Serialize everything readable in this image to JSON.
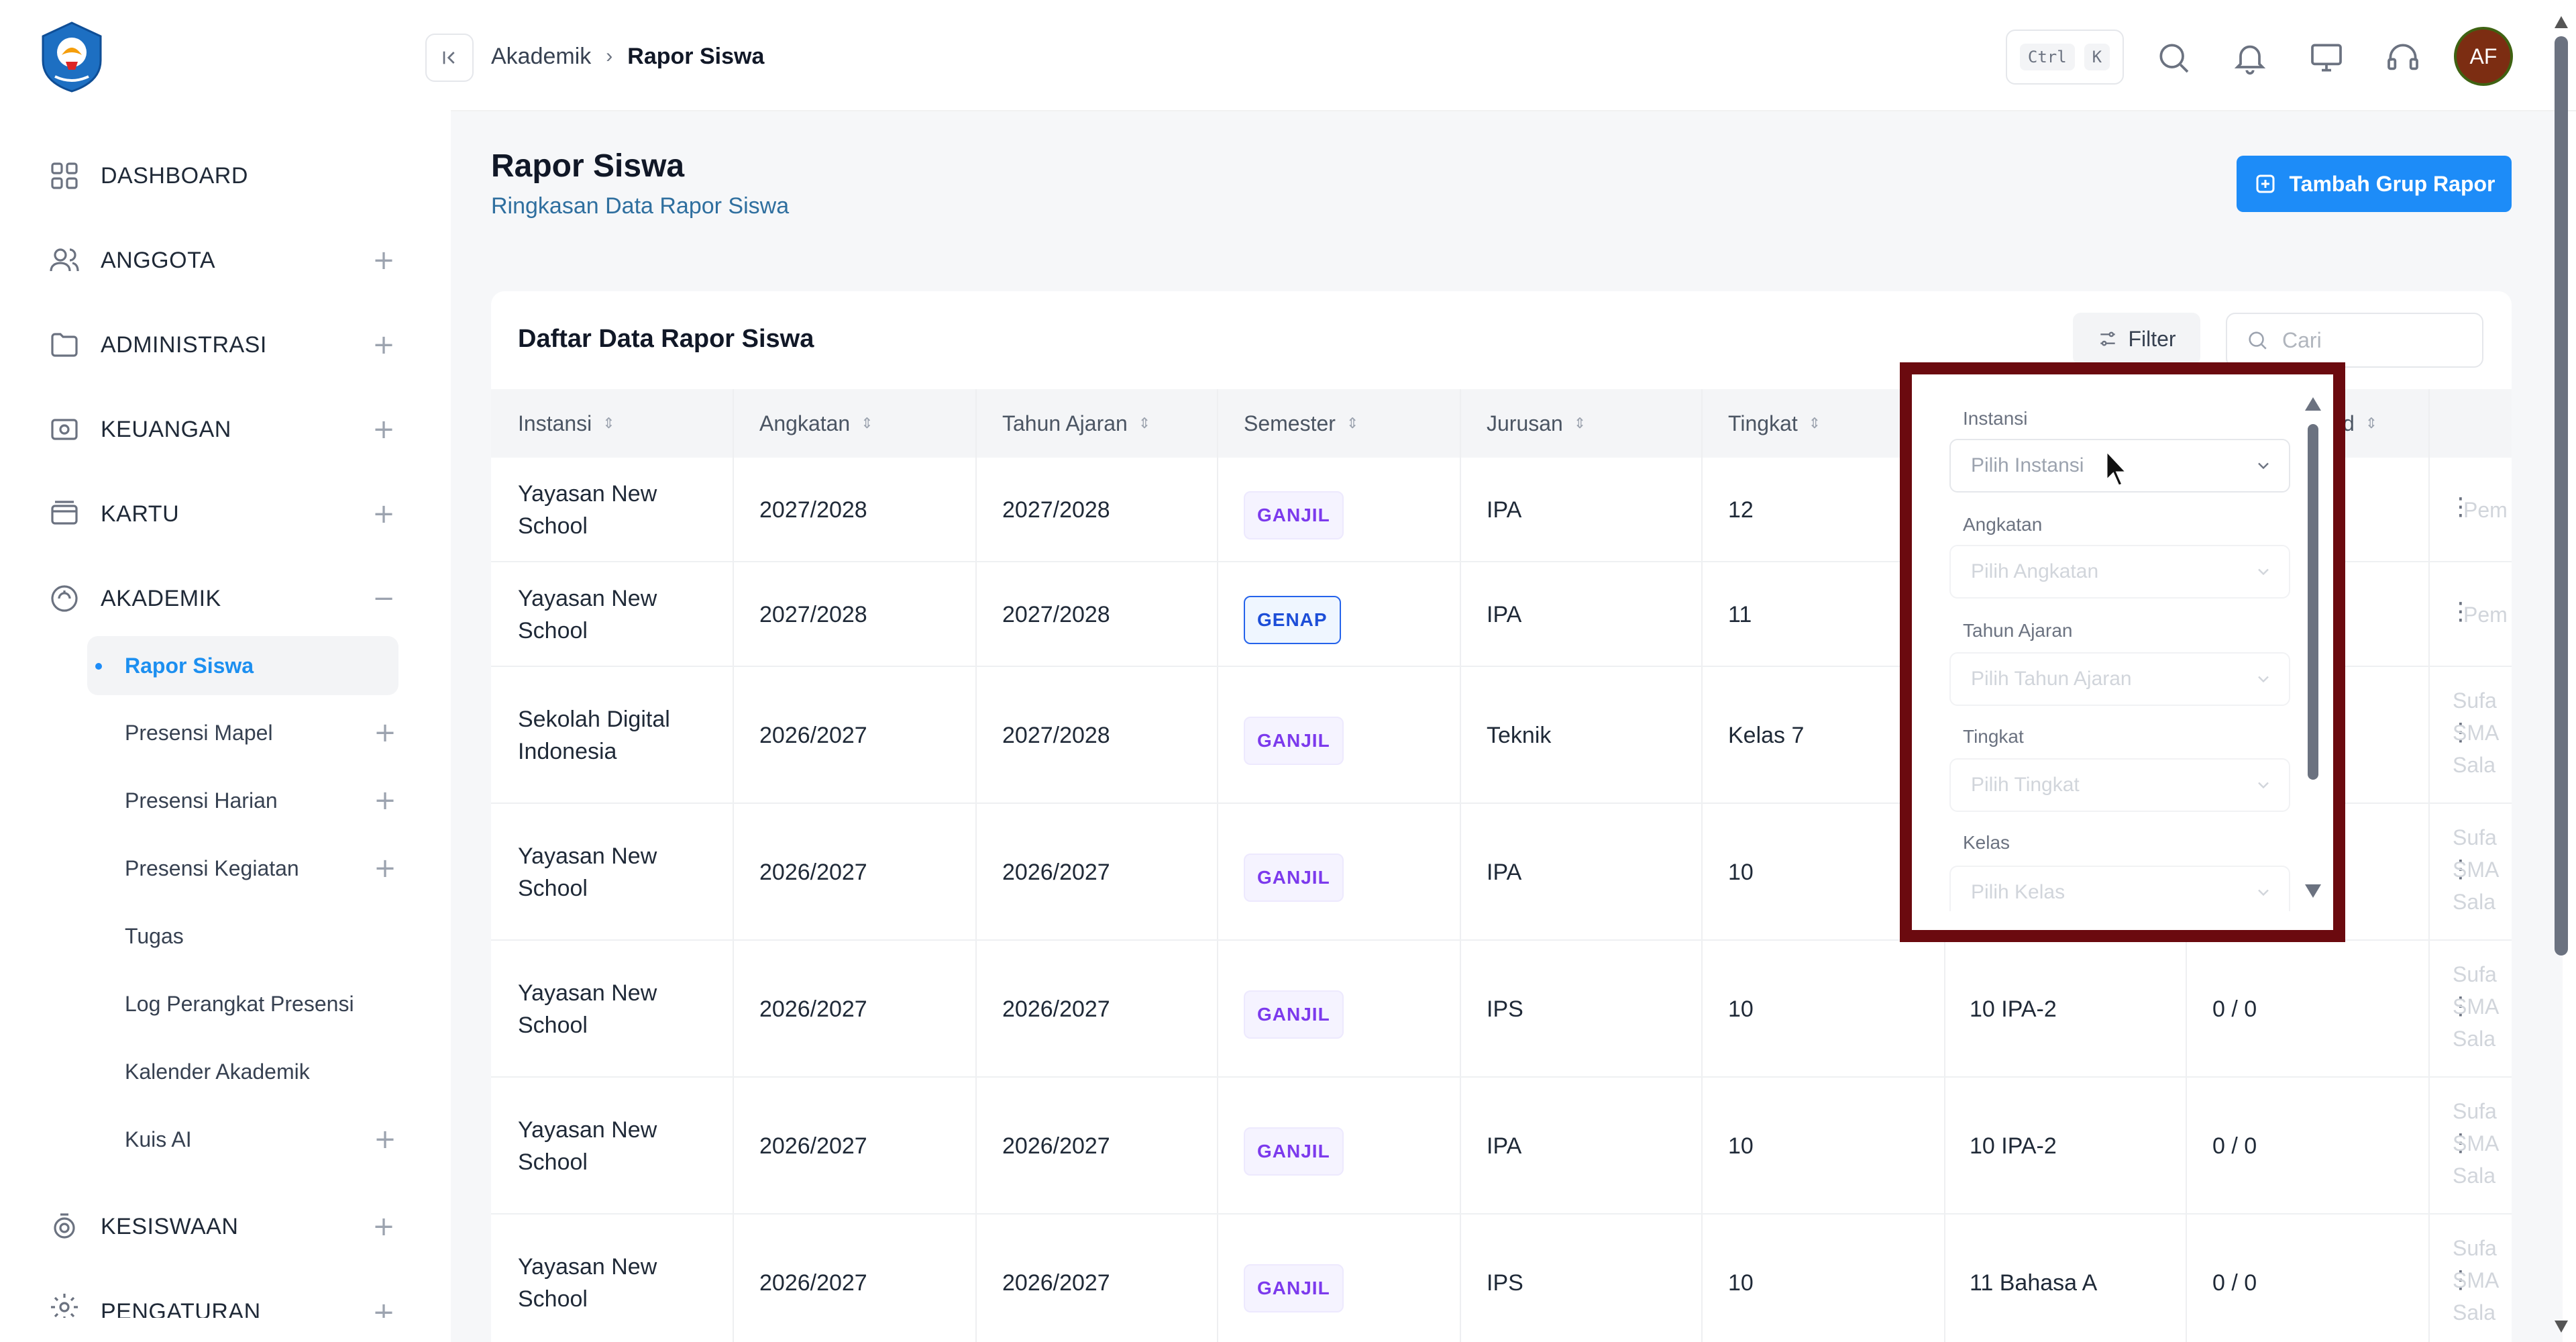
{
  "sidebar": {
    "nav": [
      {
        "label": "DASHBOARD",
        "icon": "grid-icon",
        "expandable": false
      },
      {
        "label": "ANGGOTA",
        "icon": "users-icon",
        "expandable": true,
        "state": "+"
      },
      {
        "label": "ADMINISTRASI",
        "icon": "folder-icon",
        "expandable": true,
        "state": "+"
      },
      {
        "label": "KEUANGAN",
        "icon": "wallet-icon",
        "expandable": true,
        "state": "+"
      },
      {
        "label": "KARTU",
        "icon": "card-icon",
        "expandable": true,
        "state": "+"
      },
      {
        "label": "AKADEMIK",
        "icon": "academic-icon",
        "expandable": true,
        "state": "−"
      },
      {
        "label": "KESISWAAN",
        "icon": "student-icon",
        "expandable": true,
        "state": "+"
      },
      {
        "label": "PENGATURAN",
        "icon": "settings-icon",
        "expandable": true,
        "state": "+"
      }
    ],
    "akademik_sub": [
      {
        "label": "Rapor Siswa",
        "active": true,
        "plus": false
      },
      {
        "label": "Presensi Mapel",
        "active": false,
        "plus": true
      },
      {
        "label": "Presensi Harian",
        "active": false,
        "plus": true
      },
      {
        "label": "Presensi Kegiatan",
        "active": false,
        "plus": true
      },
      {
        "label": "Tugas",
        "active": false,
        "plus": false
      },
      {
        "label": "Log Perangkat Presensi",
        "active": false,
        "plus": false
      },
      {
        "label": "Kalender Akademik",
        "active": false,
        "plus": false
      },
      {
        "label": "Kuis AI",
        "active": false,
        "plus": true
      }
    ]
  },
  "header": {
    "breadcrumb": [
      "Akademik",
      "Rapor Siswa"
    ],
    "shortcut": [
      "Ctrl",
      "K"
    ],
    "avatar_initials": "AF"
  },
  "page": {
    "title": "Rapor Siswa",
    "subtitle": "Ringkasan Data Rapor Siswa",
    "add_button": "Tambah Grup Rapor"
  },
  "table": {
    "title": "Daftar Data Rapor Siswa",
    "filter_label": "Filter",
    "search_placeholder": "Cari",
    "columns": [
      "Instansi",
      "Angkatan",
      "Tahun Ajaran",
      "Semester",
      "Jurusan",
      "Tingkat",
      "",
      "d",
      ""
    ],
    "rows": [
      {
        "instansi": [
          "Yayasan New",
          "School"
        ],
        "angkatan": "2027/2028",
        "tahun": "2027/2028",
        "semester": "GANJIL",
        "jurusan": "IPA",
        "tingkat": "12",
        "kelas": "",
        "nilai": "",
        "aksi": "Pem"
      },
      {
        "instansi": [
          "Yayasan New",
          "School"
        ],
        "angkatan": "2027/2028",
        "tahun": "2027/2028",
        "semester": "GENAP",
        "jurusan": "IPA",
        "tingkat": "11",
        "kelas": "",
        "nilai": "",
        "aksi": "Pem"
      },
      {
        "instansi": [
          "Sekolah Digital",
          "Indonesia"
        ],
        "angkatan": "2026/2027",
        "tahun": "2027/2028",
        "semester": "GANJIL",
        "jurusan": "Teknik",
        "tingkat": "Kelas 7",
        "kelas": "",
        "nilai": "",
        "aksi": "Sufa SMA Sala"
      },
      {
        "instansi": [
          "Yayasan New",
          "School"
        ],
        "angkatan": "2026/2027",
        "tahun": "2026/2027",
        "semester": "GANJIL",
        "jurusan": "IPA",
        "tingkat": "10",
        "kelas": "",
        "nilai": "",
        "aksi": "Sufa SMA Sala"
      },
      {
        "instansi": [
          "Yayasan New",
          "School"
        ],
        "angkatan": "2026/2027",
        "tahun": "2026/2027",
        "semester": "GANJIL",
        "jurusan": "IPS",
        "tingkat": "10",
        "kelas": "10 IPA-2",
        "nilai": "0 / 0",
        "aksi": "Sufa SMA Sala"
      },
      {
        "instansi": [
          "Yayasan New",
          "School"
        ],
        "angkatan": "2026/2027",
        "tahun": "2026/2027",
        "semester": "GANJIL",
        "jurusan": "IPA",
        "tingkat": "10",
        "kelas": "10 IPA-2",
        "nilai": "0 / 0",
        "aksi": "Sufa SMA Sala"
      },
      {
        "instansi": [
          "Yayasan New",
          "School"
        ],
        "angkatan": "2026/2027",
        "tahun": "2026/2027",
        "semester": "GANJIL",
        "jurusan": "IPS",
        "tingkat": "10",
        "kelas": "11 Bahasa A",
        "nilai": "0 / 0",
        "aksi": "Sufa SMA Sala"
      }
    ]
  },
  "filter_panel": {
    "fields": [
      {
        "label": "Instansi",
        "placeholder": "Pilih Instansi"
      },
      {
        "label": "Angkatan",
        "placeholder": "Pilih Angkatan"
      },
      {
        "label": "Tahun Ajaran",
        "placeholder": "Pilih Tahun Ajaran"
      },
      {
        "label": "Tingkat",
        "placeholder": "Pilih Tingkat"
      },
      {
        "label": "Kelas",
        "placeholder": "Pilih Kelas"
      }
    ]
  },
  "colors": {
    "primary": "#1d8cf8",
    "highlight_frame": "#6b0a0f",
    "ganjil": "#7c3aed",
    "genap": "#1d4ed8"
  }
}
